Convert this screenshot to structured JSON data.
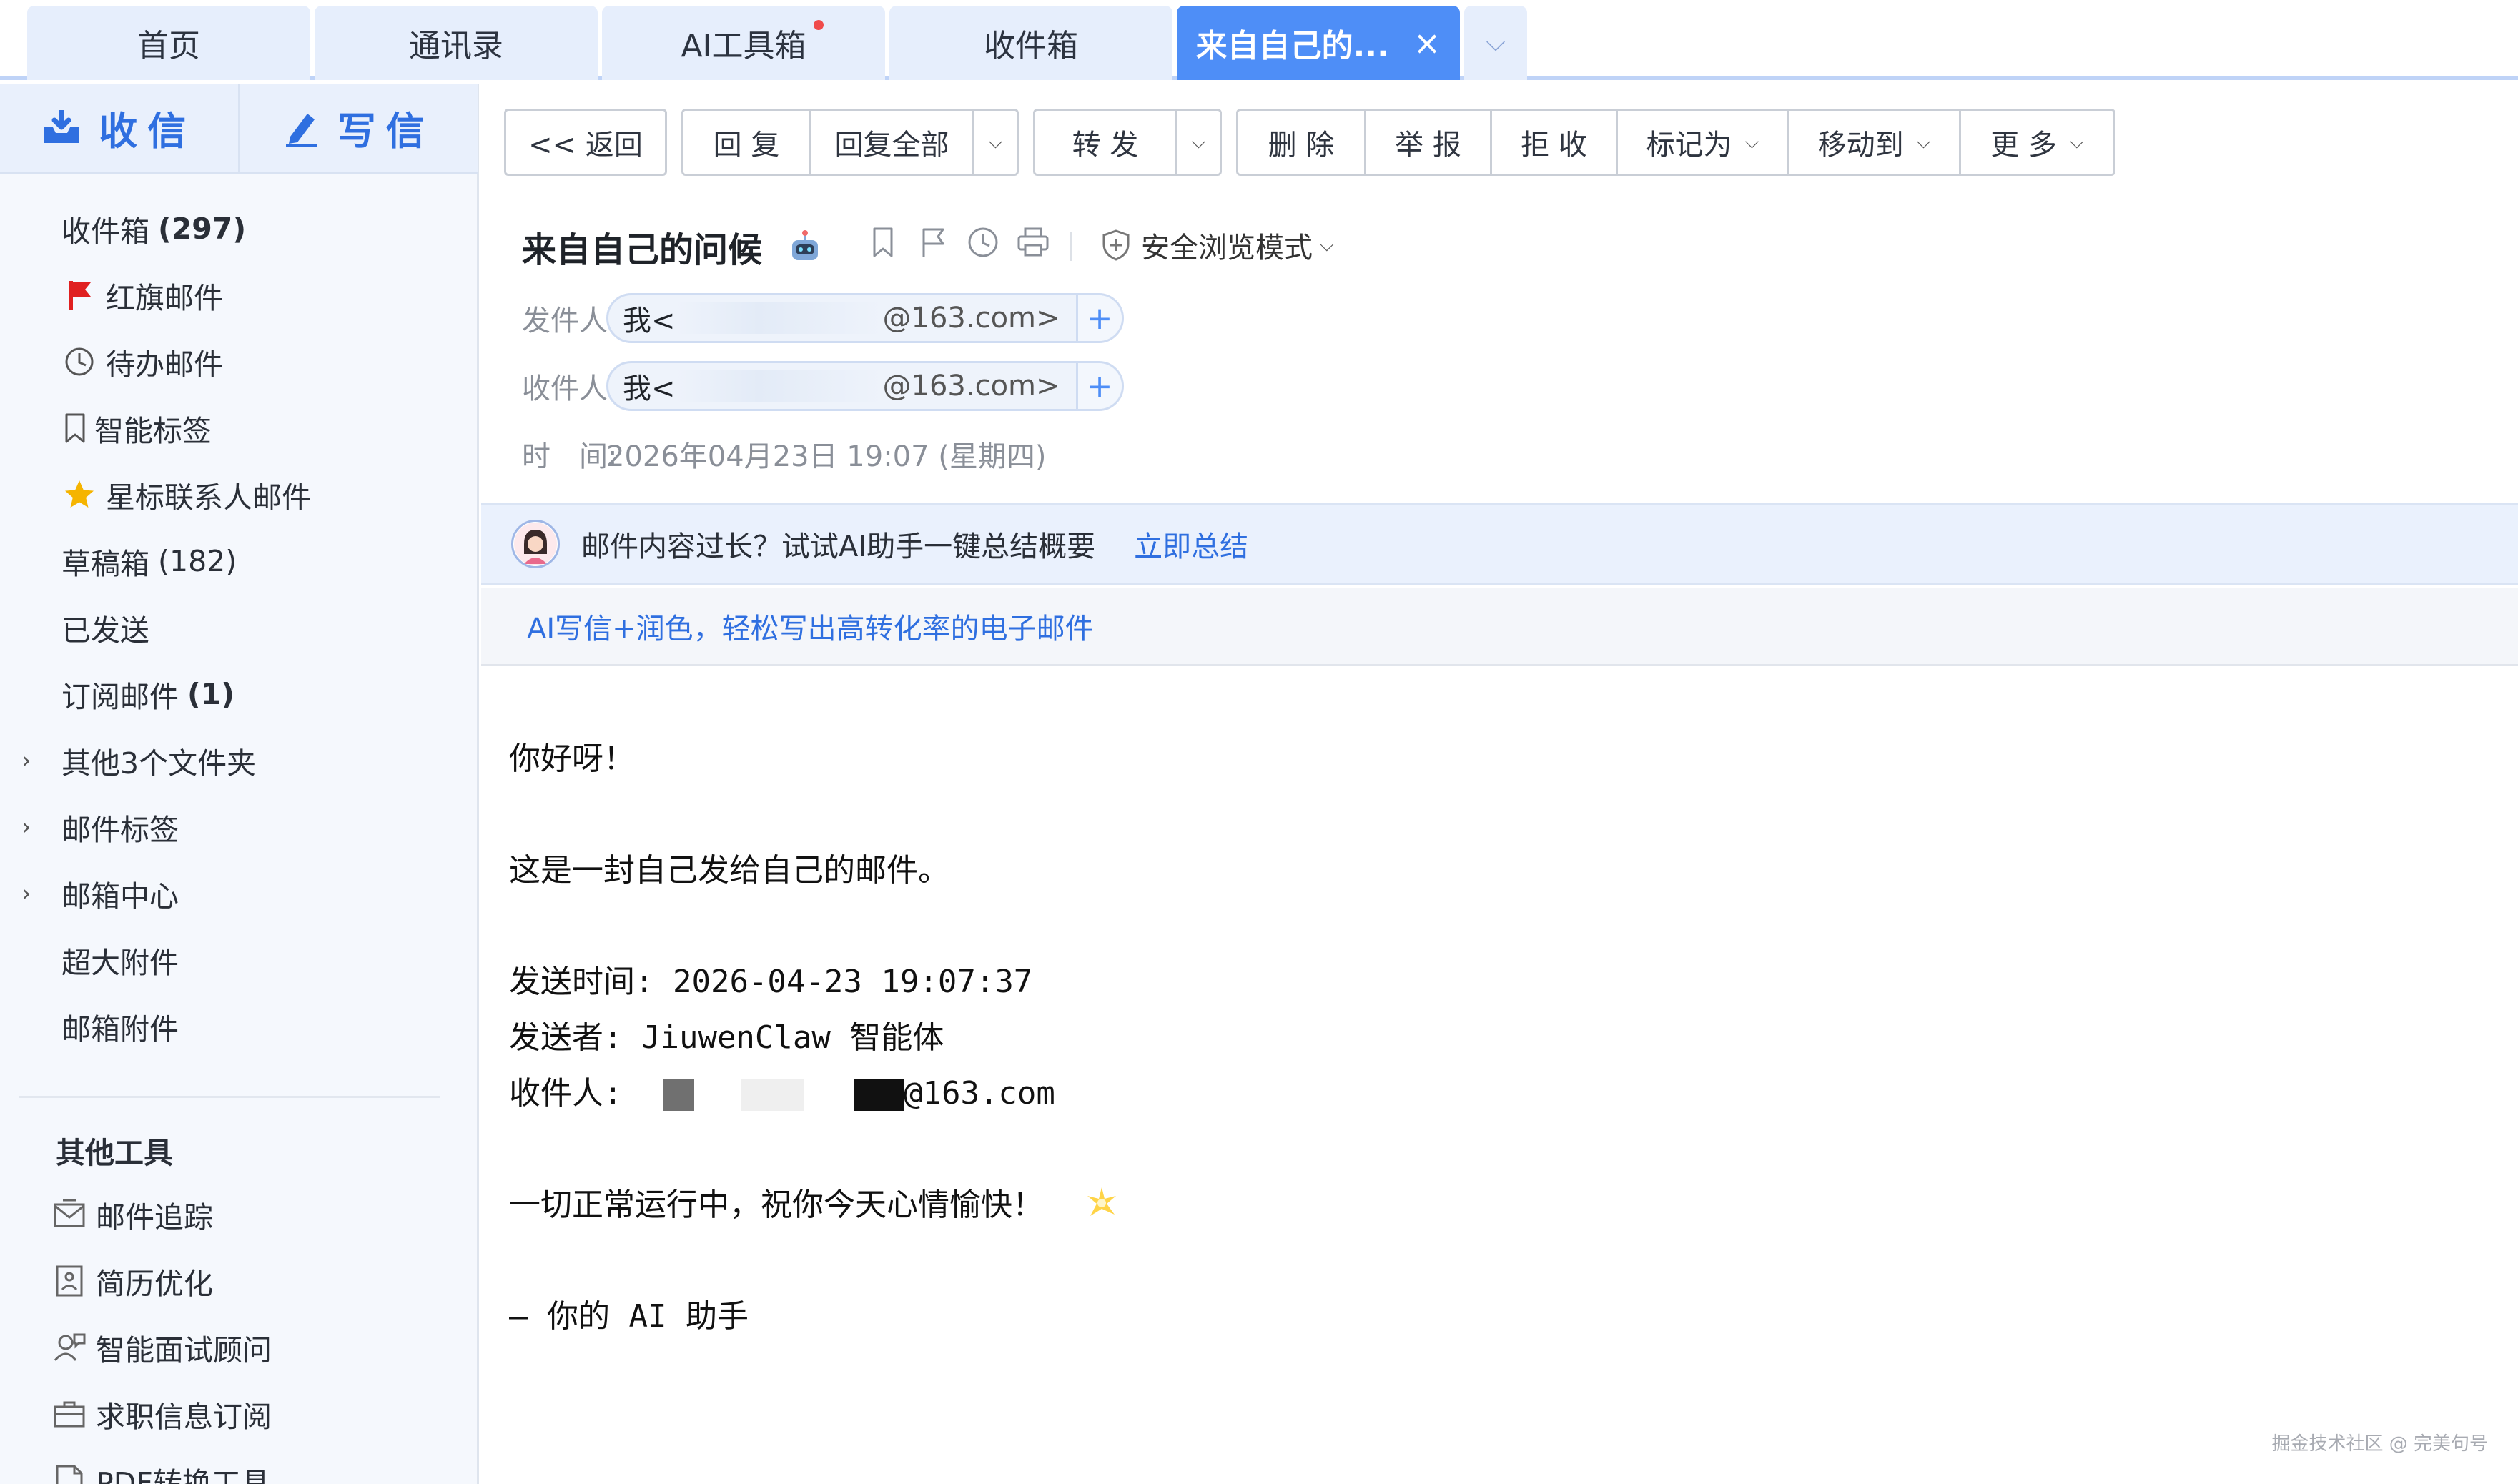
{
  "tabs": [
    {
      "label": "首页"
    },
    {
      "label": "通讯录"
    },
    {
      "label": "AI工具箱"
    },
    {
      "label": "收件箱"
    },
    {
      "label": "来自自己的..."
    }
  ],
  "tab_close_glyph": "×",
  "tab_more_glyph": "⌵",
  "sidebar": {
    "receive_label": "收信",
    "compose_label": "写信",
    "items": [
      {
        "label": "收件箱",
        "count": "(297)"
      },
      {
        "label": "红旗邮件"
      },
      {
        "label": "待办邮件"
      },
      {
        "label": "智能标签"
      },
      {
        "label": "星标联系人邮件"
      },
      {
        "label": "草稿箱",
        "count": "(182)"
      },
      {
        "label": "已发送"
      },
      {
        "label": "订阅邮件",
        "count": "(1)"
      },
      {
        "label": "其他3个文件夹"
      },
      {
        "label": "邮件标签"
      },
      {
        "label": "邮箱中心"
      },
      {
        "label": "超大附件"
      },
      {
        "label": "邮箱附件"
      }
    ],
    "tools_title": "其他工具",
    "tools": [
      {
        "label": "邮件追踪"
      },
      {
        "label": "简历优化"
      },
      {
        "label": "智能面试顾问"
      },
      {
        "label": "求职信息订阅"
      },
      {
        "label": "PDF转换工具"
      }
    ]
  },
  "toolbar": {
    "back": "<< 返回",
    "reply": "回 复",
    "reply_all": "回复全部",
    "forward": "转 发",
    "delete": "删 除",
    "report": "举 报",
    "reject": "拒 收",
    "mark_as": "标记为",
    "move_to": "移动到",
    "more": "更 多"
  },
  "mail": {
    "subject": "来自自己的问候",
    "safe_mode": "安全浏览模式",
    "from_label": "发件人:",
    "to_label": "收件人:",
    "time_label": "时　间:",
    "sender_name": "我<",
    "sender_domain": "@163.com>",
    "recipient_name": "我<",
    "recipient_domain": "@163.com>",
    "time": "2026年04月23日 19:07 (星期四)"
  },
  "banner": {
    "ai_prompt": "邮件内容过长？试试AI助手一键总结概要",
    "ai_action": "立即总结",
    "ai_writing": "AI写信+润色，轻松写出高转化率的电子邮件"
  },
  "body": {
    "greeting": "你好呀！",
    "line1": "这是一封自己发给自己的邮件。",
    "send_time": "发送时间: 2026-04-23 19:07:37",
    "sender": "发送者: JiuwenClaw 智能体",
    "recipient_label": "收件人: ",
    "recipient_domain": "@163.com",
    "closing": "一切正常运行中，祝你今天心情愉快！",
    "signature": "— 你的 AI 助手"
  },
  "watermark": "掘金技术社区 @ 完美句号",
  "colors": {
    "accent": "#4e8ef7",
    "link": "#2f6fe0",
    "tab_bg": "#e6eefc",
    "sidebar_bg": "#f5f8fd",
    "flag_red": "#e02020",
    "star_gold": "#f5b400"
  }
}
